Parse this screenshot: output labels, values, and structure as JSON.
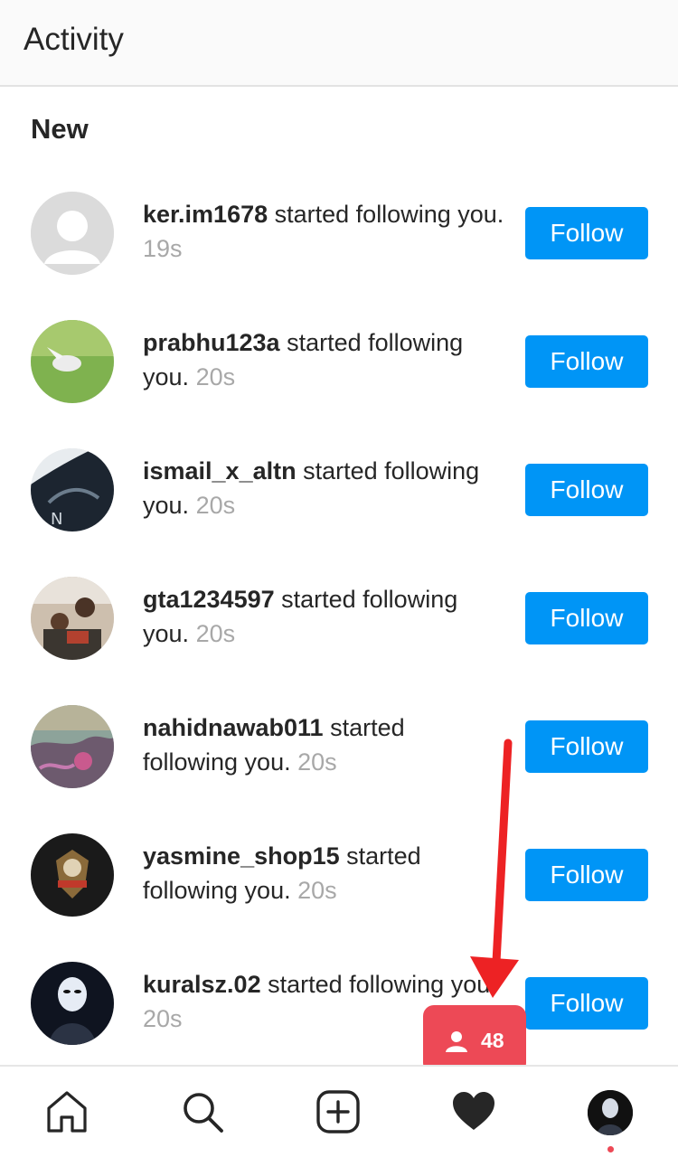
{
  "header": {
    "title": "Activity"
  },
  "section": {
    "title": "New"
  },
  "notifications": [
    {
      "username": "ker.im1678",
      "action": " started following you.",
      "time": "19s",
      "button": "Follow"
    },
    {
      "username": "prabhu123a",
      "action": " started following you.",
      "time": "20s",
      "button": "Follow"
    },
    {
      "username": "ismail_x_altn",
      "action": " started following you.",
      "time": "20s",
      "button": "Follow"
    },
    {
      "username": "gta1234597",
      "action": " started following you.",
      "time": "20s",
      "button": "Follow"
    },
    {
      "username": "nahidnawab011",
      "action": " started following you.",
      "time": "20s",
      "button": "Follow"
    },
    {
      "username": "yasmine_shop15",
      "action": " started following you.",
      "time": "20s",
      "button": "Follow"
    },
    {
      "username": "kuralsz.02",
      "action": " started following you.",
      "time": "20s",
      "button": "Follow"
    }
  ],
  "activity_badge": {
    "count": "48",
    "icon": "person-icon"
  },
  "nav": {
    "items": [
      "home-icon",
      "search-icon",
      "create-icon",
      "heart-icon",
      "profile-avatar"
    ]
  },
  "colors": {
    "follow_button": "#0095f6",
    "badge": "#ed4956",
    "arrow": "#ed2224"
  }
}
